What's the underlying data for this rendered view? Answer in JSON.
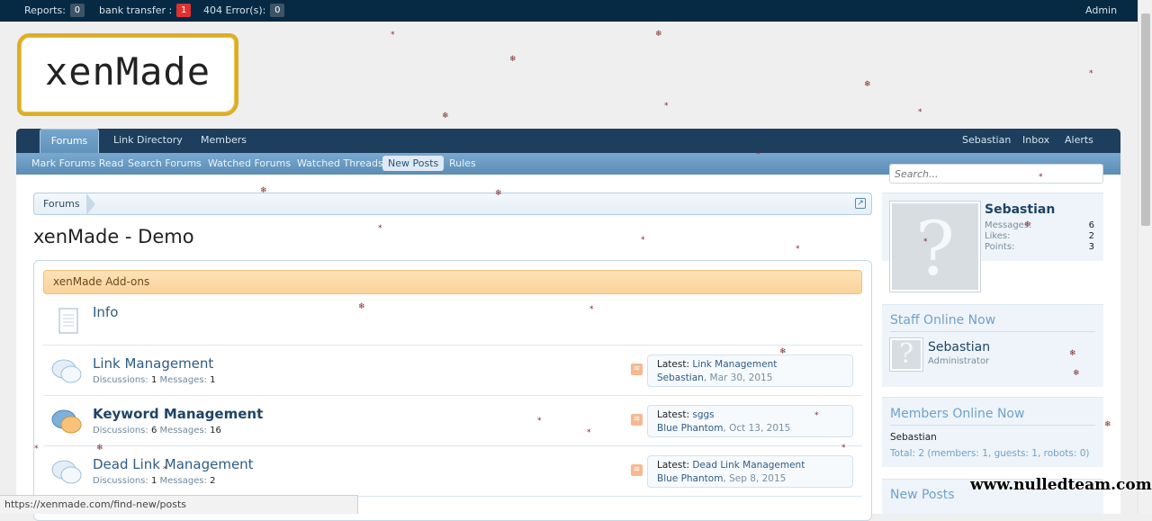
{
  "admin_bar": {
    "reports_label": "Reports:",
    "reports_count": "0",
    "bank_label": "bank transfer :",
    "bank_count": "1",
    "errors_label": "404 Error(s):",
    "errors_count": "0",
    "admin_label": "Admin",
    "alert_color": "#e03030"
  },
  "logo": {
    "text": "xenMade"
  },
  "nav": {
    "tabs": [
      {
        "label": "Forums"
      },
      {
        "label": "Link Directory"
      },
      {
        "label": "Members"
      }
    ],
    "right": [
      {
        "label": "Sebastian"
      },
      {
        "label": "Inbox"
      },
      {
        "label": "Alerts"
      }
    ],
    "sub": [
      {
        "label": "Mark Forums Read"
      },
      {
        "label": "Search Forums"
      },
      {
        "label": "Watched Forums"
      },
      {
        "label": "Watched Threads"
      },
      {
        "label": "New Posts"
      },
      {
        "label": "Rules"
      }
    ]
  },
  "breadcrumb": {
    "item": "Forums",
    "jump_icon": "jump-icon"
  },
  "page_title": "xenMade - Demo",
  "category": {
    "title": "xenMade Add-ons"
  },
  "nodes": [
    {
      "icon": "page-icon",
      "name": "Info"
    },
    {
      "icon": "chat-bubbles-icon",
      "name": "Link Management",
      "disc_label": "Discussions:",
      "disc": "1",
      "msg_label": "Messages:",
      "msg": "1",
      "latest_label": "Latest:",
      "latest_title": "Link Management",
      "latest_user": "Sebastian",
      "latest_date": "Mar 30, 2015"
    },
    {
      "icon": "chat-bubbles-unread-icon",
      "name": "Keyword Management",
      "disc_label": "Discussions:",
      "disc": "6",
      "msg_label": "Messages:",
      "msg": "16",
      "latest_label": "Latest:",
      "latest_title": "sggs",
      "latest_user": "Blue Phantom",
      "latest_date": "Oct 13, 2015"
    },
    {
      "icon": "chat-bubbles-icon",
      "name": "Dead Link Management",
      "disc_label": "Discussions:",
      "disc": "1",
      "msg_label": "Messages:",
      "msg": "2",
      "latest_label": "Latest:",
      "latest_title": "Dead Link Management",
      "latest_user": "Blue Phantom",
      "latest_date": "Sep 8, 2015"
    }
  ],
  "sidebar": {
    "search_placeholder": "Search...",
    "visitor": {
      "name": "Sebastian",
      "stats": [
        {
          "label": "Messages:",
          "value": "6"
        },
        {
          "label": "Likes:",
          "value": "2"
        },
        {
          "label": "Points:",
          "value": "3"
        }
      ]
    },
    "staff_heading": "Staff Online Now",
    "staff_name": "Sebastian",
    "staff_role": "Administrator",
    "members_heading": "Members Online Now",
    "members_name": "Sebastian",
    "members_total": "Total: 2 (members: 1, guests: 1, robots: 0)",
    "new_posts_heading": "New Posts"
  },
  "status_url": "https://xenmade.com/find-new/posts",
  "watermark": "www.nulledteam.com"
}
